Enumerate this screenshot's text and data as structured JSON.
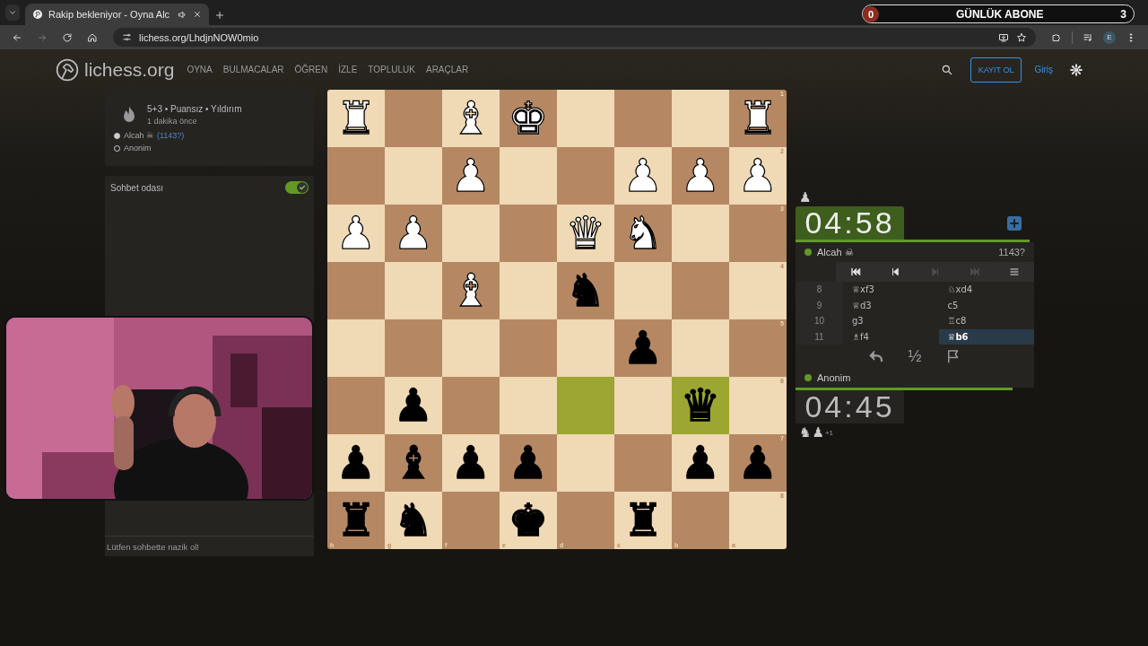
{
  "browser": {
    "tab": {
      "title": "Rakip bekleniyor - Oyna Alc"
    },
    "url": "lichess.org/LhdjnNOW0mio",
    "profile": "E"
  },
  "overlay": {
    "start": "0",
    "label": "GÜNLÜK ABONE",
    "goal": "3"
  },
  "header": {
    "logo": "lichess.org",
    "nav": [
      "OYNA",
      "BULMACALAR",
      "ÖĞREN",
      "İZLE",
      "TOPLULUK",
      "ARAÇLAR"
    ],
    "signup": "KAYIT OL",
    "login": "Giriş"
  },
  "game_info": {
    "title": "5+3 • Puansız • Yıldırım",
    "time": "1 dakika önce",
    "players": [
      {
        "name": "Alcah ☠",
        "rating": "(1143?)",
        "filled": true
      },
      {
        "name": "Anonim",
        "filled": false
      }
    ]
  },
  "chat": {
    "title": "Sohbet odası",
    "on": true,
    "placeholder": "Lütfen sohbette nazik ol!"
  },
  "board": {
    "ranks": [
      "1",
      "2",
      "3",
      "4",
      "5",
      "6",
      "7",
      "8"
    ],
    "files": [
      "h",
      "g",
      "f",
      "e",
      "d",
      "c",
      "b",
      "a"
    ],
    "rows": [
      [
        {
          "piece": "♜",
          "color": "#ffffff",
          "highlighted": false
        },
        {
          "highlighted": false
        },
        {
          "piece": "♝",
          "color": "#ffffff",
          "highlighted": false
        },
        {
          "piece": "♚",
          "color": "#ffffff",
          "highlighted": false
        },
        {
          "highlighted": false
        },
        {
          "highlighted": false
        },
        {
          "highlighted": false
        },
        {
          "piece": "♜",
          "color": "#ffffff",
          "highlighted": false
        }
      ],
      [
        {
          "highlighted": false
        },
        {
          "highlighted": false
        },
        {
          "piece": "♟",
          "color": "#ffffff",
          "highlighted": false
        },
        {
          "highlighted": false
        },
        {
          "highlighted": false
        },
        {
          "piece": "♟",
          "color": "#ffffff",
          "highlighted": false
        },
        {
          "piece": "♟",
          "color": "#ffffff",
          "highlighted": false
        },
        {
          "piece": "♟",
          "color": "#ffffff",
          "highlighted": false
        }
      ],
      [
        {
          "piece": "♟",
          "color": "#ffffff",
          "highlighted": false
        },
        {
          "piece": "♟",
          "color": "#ffffff",
          "highlighted": false
        },
        {
          "highlighted": false
        },
        {
          "highlighted": false
        },
        {
          "piece": "♛",
          "color": "#ffffff",
          "highlighted": false
        },
        {
          "piece": "♞",
          "color": "#ffffff",
          "highlighted": false
        },
        {
          "highlighted": false
        },
        {
          "highlighted": false
        }
      ],
      [
        {
          "highlighted": false
        },
        {
          "highlighted": false
        },
        {
          "piece": "♝",
          "color": "#ffffff",
          "highlighted": false
        },
        {
          "highlighted": false
        },
        {
          "piece": "♞",
          "color": "#000000",
          "highlighted": false
        },
        {
          "highlighted": false
        },
        {
          "highlighted": false
        },
        {
          "highlighted": false
        }
      ],
      [
        {
          "highlighted": false
        },
        {
          "highlighted": false
        },
        {
          "highlighted": false
        },
        {
          "highlighted": false
        },
        {
          "highlighted": false
        },
        {
          "piece": "♟",
          "color": "#000000",
          "highlighted": false
        },
        {
          "highlighted": false
        },
        {
          "highlighted": false
        }
      ],
      [
        {
          "highlighted": false
        },
        {
          "piece": "♟",
          "color": "#000000",
          "highlighted": false
        },
        {
          "highlighted": false
        },
        {
          "highlighted": false
        },
        {
          "highlighted": true
        },
        {
          "highlighted": false
        },
        {
          "piece": "♛",
          "color": "#000000",
          "highlighted": true
        },
        {
          "highlighted": false
        }
      ],
      [
        {
          "piece": "♟",
          "color": "#000000",
          "highlighted": false
        },
        {
          "piece": "♝",
          "color": "#000000",
          "highlighted": false
        },
        {
          "piece": "♟",
          "color": "#000000",
          "highlighted": false
        },
        {
          "piece": "♟",
          "color": "#000000",
          "highlighted": false
        },
        {
          "highlighted": false
        },
        {
          "highlighted": false
        },
        {
          "piece": "♟",
          "color": "#000000",
          "highlighted": false
        },
        {
          "piece": "♟",
          "color": "#000000",
          "highlighted": false
        }
      ],
      [
        {
          "piece": "♜",
          "color": "#000000",
          "highlighted": false
        },
        {
          "piece": "♞",
          "color": "#000000",
          "highlighted": false
        },
        {
          "highlighted": false
        },
        {
          "piece": "♚",
          "color": "#000000",
          "highlighted": false
        },
        {
          "highlighted": false
        },
        {
          "piece": "♜",
          "color": "#000000",
          "highlighted": false
        },
        {
          "highlighted": false
        },
        {
          "highlighted": false
        }
      ]
    ]
  },
  "top_player": {
    "material": [
      "♟"
    ],
    "clock": "04:58",
    "running": true,
    "level": 0.98,
    "name": "Alcah ☠",
    "rating": "1143?"
  },
  "controls": [
    {
      "kind": "first",
      "disabled": false
    },
    {
      "kind": "prev",
      "disabled": false
    },
    {
      "kind": "next",
      "disabled": true
    },
    {
      "kind": "last",
      "disabled": true
    },
    {
      "kind": "menu",
      "disabled": false
    }
  ],
  "moves": [
    {
      "number": "8",
      "white": {
        "san": "♕xf3",
        "selected": false
      },
      "black": {
        "san": "♘xd4",
        "selected": false
      }
    },
    {
      "number": "9",
      "white": {
        "san": "♕d3",
        "selected": false
      },
      "black": {
        "san": "c5",
        "selected": false
      }
    },
    {
      "number": "10",
      "white": {
        "san": "g3",
        "selected": false
      },
      "black": {
        "san": "♖c8",
        "selected": false
      }
    },
    {
      "number": "11",
      "white": {
        "san": "♗f4",
        "selected": false
      },
      "black": {
        "san": "♕b6",
        "selected": true
      }
    }
  ],
  "actions": [
    {
      "kind": "takeback"
    },
    {
      "kind": "draw",
      "label": "½"
    },
    {
      "kind": "resign"
    }
  ],
  "bottom_player": {
    "name": "Anonim",
    "level": 0.91,
    "clock": "04:45",
    "running": false,
    "material": [
      "♞",
      "♟"
    ],
    "diff": "+1"
  }
}
